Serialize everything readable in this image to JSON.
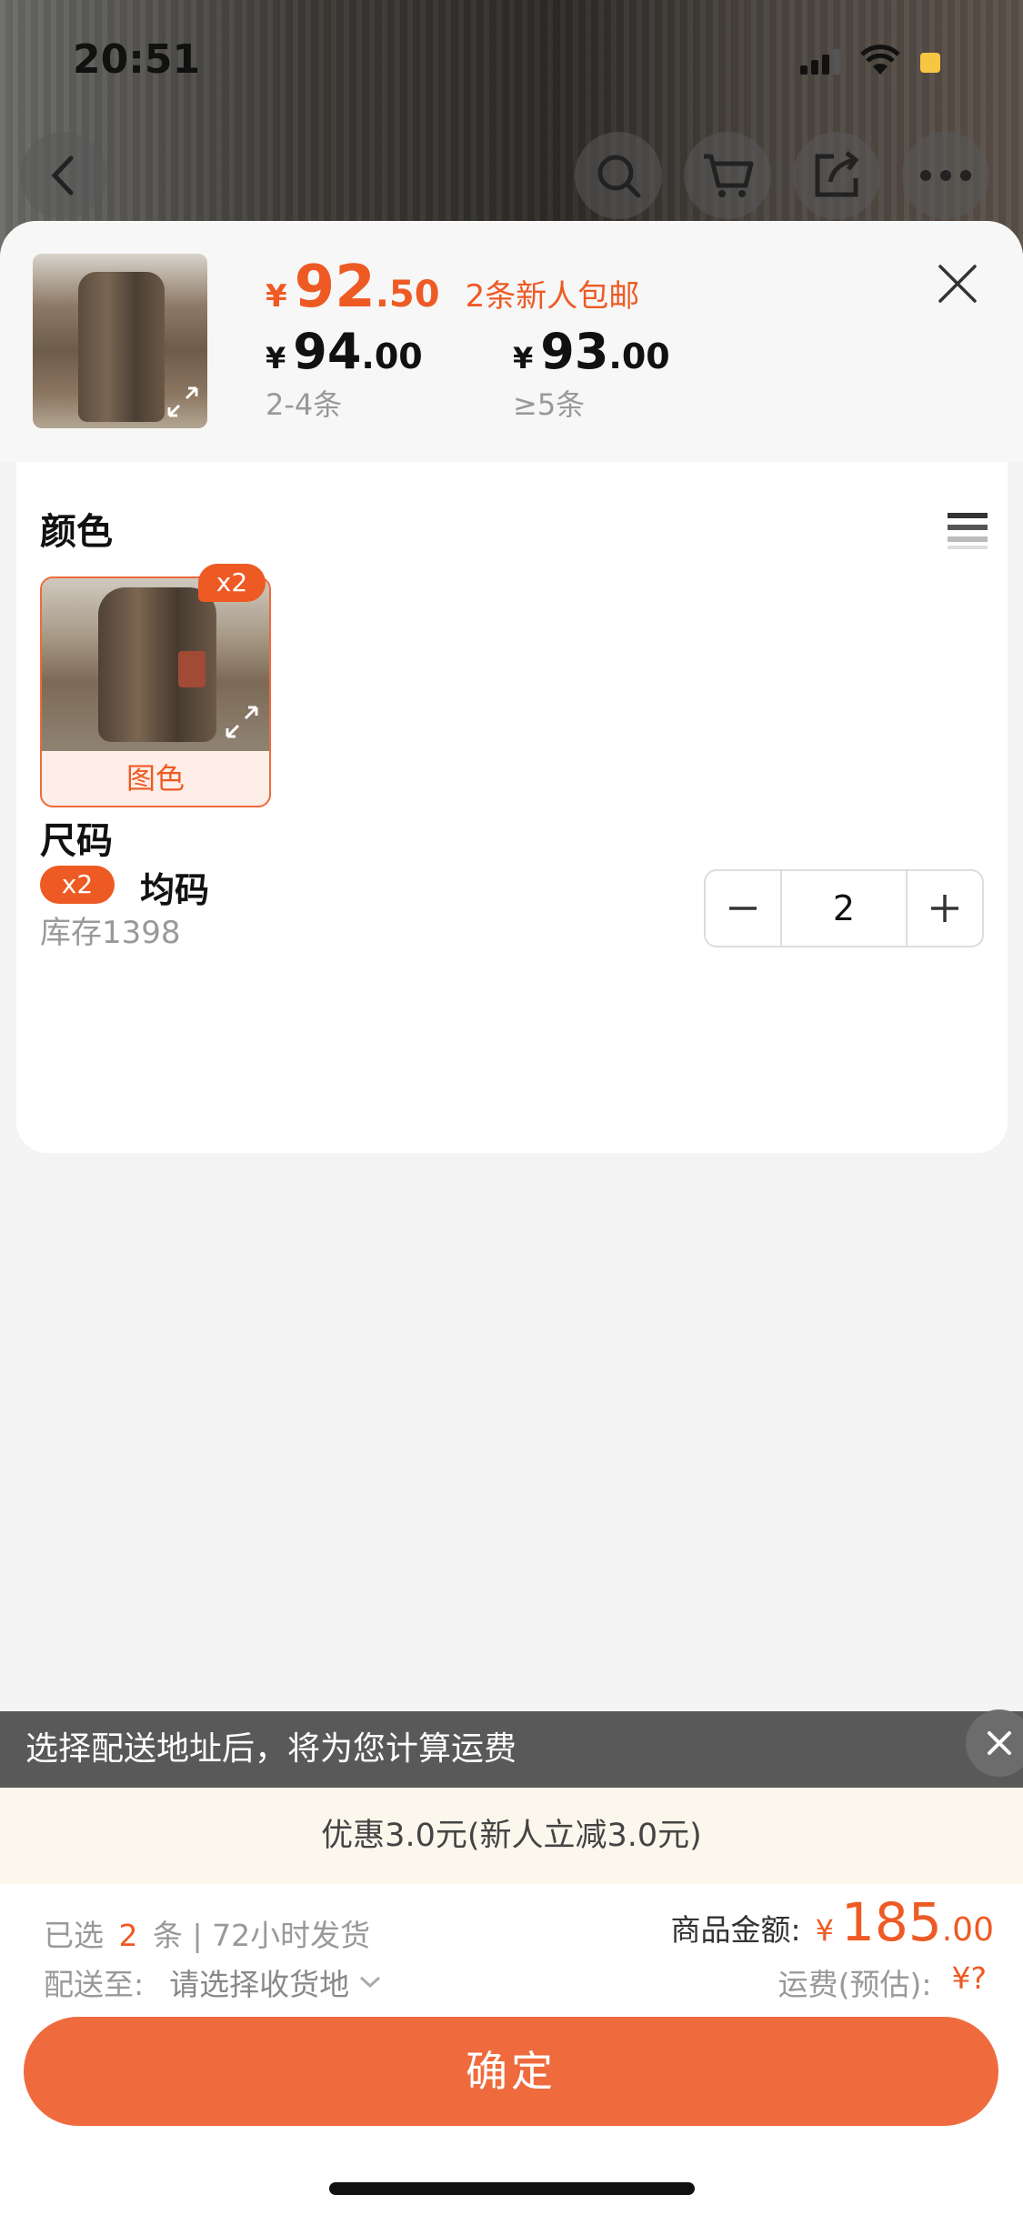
{
  "status_bar": {
    "time": "20:51"
  },
  "header": {
    "main_price": {
      "currency": "¥",
      "integer": "92",
      "decimal": ".50"
    },
    "promo_tag": "2条新人包邮",
    "tiers": [
      {
        "currency": "¥",
        "integer": "94",
        "decimal": ".00",
        "range": "2-4条"
      },
      {
        "currency": "¥",
        "integer": "93",
        "decimal": ".00",
        "range": "≥5条"
      }
    ]
  },
  "color_section": {
    "title": "颜色",
    "options": [
      {
        "label": "图色",
        "badge": "x2",
        "selected": true
      }
    ]
  },
  "size_section": {
    "title": "尺码",
    "item": {
      "badge": "x2",
      "name": "均码",
      "stock": "库存1398",
      "quantity": "2"
    }
  },
  "shipping_tip": "选择配送地址后，将为您计算运费",
  "promo_bar": "优惠3.0元(新人立减3.0元)",
  "footer": {
    "selected_prefix": "已选",
    "selected_count": "2",
    "selected_suffix": "条 | 72小时发货",
    "deliver_label": "配送至:",
    "deliver_value": "请选择收货地",
    "amount_label": "商品金额:",
    "amount": {
      "currency": "¥",
      "integer": "185",
      "decimal": ".00"
    },
    "freight_label": "运费(预估):",
    "freight_value": "¥?",
    "confirm_label": "确定"
  },
  "colors": {
    "accent": "#ee5a24",
    "button": "#ef6b3d",
    "promo_bg": "#fbf7ec"
  }
}
